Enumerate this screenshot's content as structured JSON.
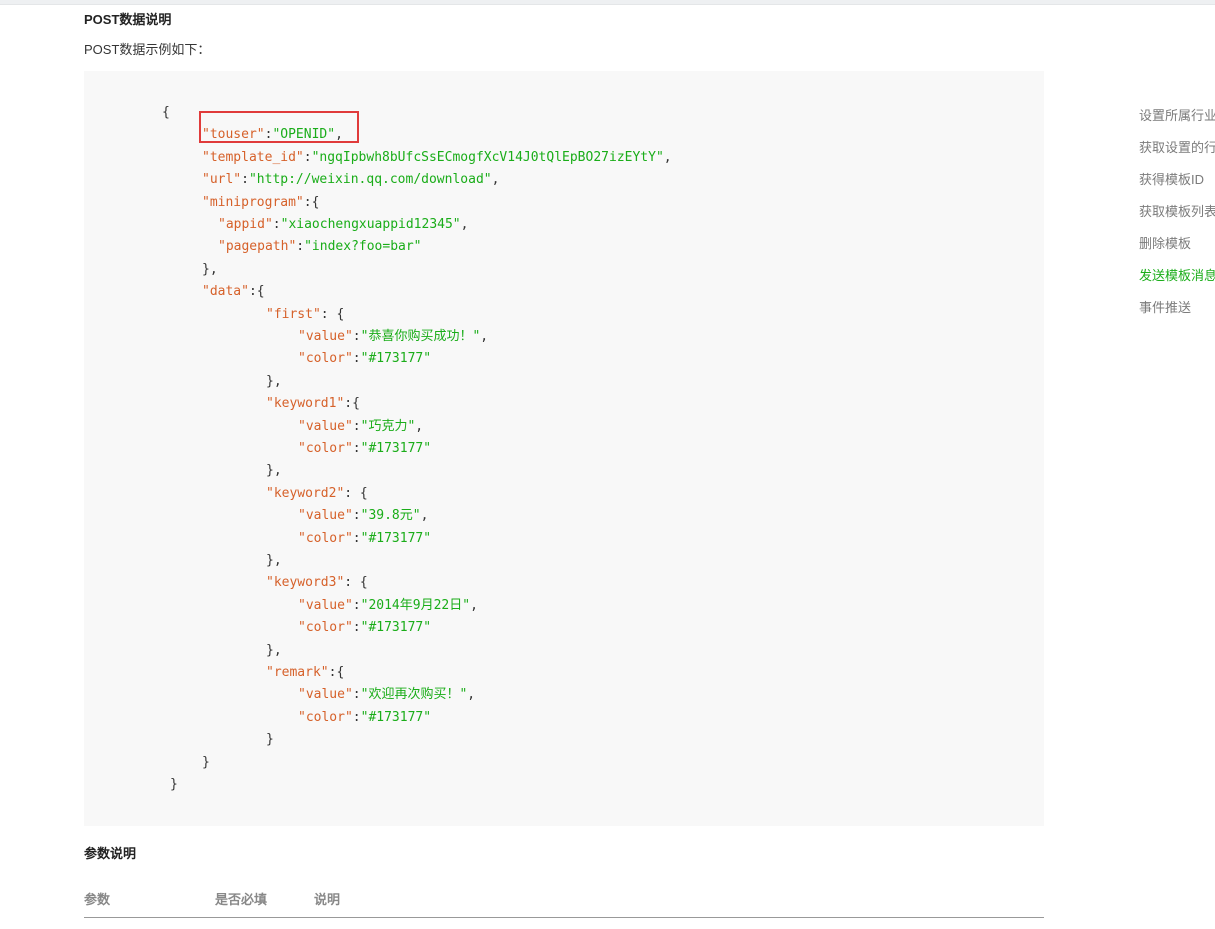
{
  "section": {
    "title": "POST数据说明",
    "intro": "POST数据示例如下："
  },
  "code_lines": [
    [
      {
        "t": "{",
        "c": "punc"
      }
    ],
    [
      {
        "t": "\"touser\"",
        "c": "key"
      },
      {
        "t": ":",
        "c": "punc"
      },
      {
        "t": "\"OPENID\"",
        "c": "str"
      },
      {
        "t": ",",
        "c": "punc"
      }
    ],
    [
      {
        "t": "\"template_id\"",
        "c": "key"
      },
      {
        "t": ":",
        "c": "punc"
      },
      {
        "t": "\"ngqIpbwh8bUfcSsECmogfXcV14J0tQlEpBO27izEYtY\"",
        "c": "str"
      },
      {
        "t": ",",
        "c": "punc"
      }
    ],
    [
      {
        "t": "\"url\"",
        "c": "key"
      },
      {
        "t": ":",
        "c": "punc"
      },
      {
        "t": "\"http://weixin.qq.com/download\"",
        "c": "str"
      },
      {
        "t": ",",
        "c": "punc"
      }
    ],
    [
      {
        "t": "\"miniprogram\"",
        "c": "key"
      },
      {
        "t": ":{",
        "c": "punc"
      }
    ],
    [
      {
        "t": "\"appid\"",
        "c": "key"
      },
      {
        "t": ":",
        "c": "punc"
      },
      {
        "t": "\"xiaochengxuappid12345\"",
        "c": "str"
      },
      {
        "t": ",",
        "c": "punc"
      }
    ],
    [
      {
        "t": "\"pagepath\"",
        "c": "key"
      },
      {
        "t": ":",
        "c": "punc"
      },
      {
        "t": "\"index?foo=bar\"",
        "c": "str"
      }
    ],
    [
      {
        "t": "},",
        "c": "punc"
      }
    ],
    [
      {
        "t": "\"data\"",
        "c": "key"
      },
      {
        "t": ":{",
        "c": "punc"
      }
    ],
    [
      {
        "t": "\"first\"",
        "c": "key"
      },
      {
        "t": ": {",
        "c": "punc"
      }
    ],
    [
      {
        "t": "\"value\"",
        "c": "key"
      },
      {
        "t": ":",
        "c": "punc"
      },
      {
        "t": "\"恭喜你购买成功！\"",
        "c": "str"
      },
      {
        "t": ",",
        "c": "punc"
      }
    ],
    [
      {
        "t": "\"color\"",
        "c": "key"
      },
      {
        "t": ":",
        "c": "punc"
      },
      {
        "t": "\"#173177\"",
        "c": "str"
      }
    ],
    [
      {
        "t": "},",
        "c": "punc"
      }
    ],
    [
      {
        "t": "\"keyword1\"",
        "c": "key"
      },
      {
        "t": ":{",
        "c": "punc"
      }
    ],
    [
      {
        "t": "\"value\"",
        "c": "key"
      },
      {
        "t": ":",
        "c": "punc"
      },
      {
        "t": "\"巧克力\"",
        "c": "str"
      },
      {
        "t": ",",
        "c": "punc"
      }
    ],
    [
      {
        "t": "\"color\"",
        "c": "key"
      },
      {
        "t": ":",
        "c": "punc"
      },
      {
        "t": "\"#173177\"",
        "c": "str"
      }
    ],
    [
      {
        "t": "},",
        "c": "punc"
      }
    ],
    [
      {
        "t": "\"keyword2\"",
        "c": "key"
      },
      {
        "t": ": {",
        "c": "punc"
      }
    ],
    [
      {
        "t": "\"value\"",
        "c": "key"
      },
      {
        "t": ":",
        "c": "punc"
      },
      {
        "t": "\"39.8元\"",
        "c": "str"
      },
      {
        "t": ",",
        "c": "punc"
      }
    ],
    [
      {
        "t": "\"color\"",
        "c": "key"
      },
      {
        "t": ":",
        "c": "punc"
      },
      {
        "t": "\"#173177\"",
        "c": "str"
      }
    ],
    [
      {
        "t": "},",
        "c": "punc"
      }
    ],
    [
      {
        "t": "\"keyword3\"",
        "c": "key"
      },
      {
        "t": ": {",
        "c": "punc"
      }
    ],
    [
      {
        "t": "\"value\"",
        "c": "key"
      },
      {
        "t": ":",
        "c": "punc"
      },
      {
        "t": "\"2014年9月22日\"",
        "c": "str"
      },
      {
        "t": ",",
        "c": "punc"
      }
    ],
    [
      {
        "t": "\"color\"",
        "c": "key"
      },
      {
        "t": ":",
        "c": "punc"
      },
      {
        "t": "\"#173177\"",
        "c": "str"
      }
    ],
    [
      {
        "t": "},",
        "c": "punc"
      }
    ],
    [
      {
        "t": "\"remark\"",
        "c": "key"
      },
      {
        "t": ":{",
        "c": "punc"
      }
    ],
    [
      {
        "t": "\"value\"",
        "c": "key"
      },
      {
        "t": ":",
        "c": "punc"
      },
      {
        "t": "\"欢迎再次购买！\"",
        "c": "str"
      },
      {
        "t": ",",
        "c": "punc"
      }
    ],
    [
      {
        "t": "\"color\"",
        "c": "key"
      },
      {
        "t": ":",
        "c": "punc"
      },
      {
        "t": "\"#173177\"",
        "c": "str"
      }
    ],
    [
      {
        "t": "}",
        "c": "punc"
      }
    ],
    [
      {
        "t": "}",
        "c": "punc"
      }
    ],
    [
      {
        "t": "}",
        "c": "punc"
      }
    ]
  ],
  "params": {
    "title": "参数说明",
    "headers": [
      "参数",
      "是否必填",
      "说明"
    ]
  },
  "sidenav": {
    "items": [
      {
        "label": "设置所属行业",
        "active": false
      },
      {
        "label": "获取设置的行业信息",
        "active": false
      },
      {
        "label": "获得模板ID",
        "active": false
      },
      {
        "label": "获取模板列表",
        "active": false
      },
      {
        "label": "删除模板",
        "active": false
      },
      {
        "label": "发送模板消息",
        "active": true
      },
      {
        "label": "事件推送",
        "active": false
      }
    ]
  },
  "colors": {
    "json_key": "#d6612a",
    "json_string": "#1aad19",
    "highlight_border": "#e03b3b",
    "active_nav": "#1aad19"
  }
}
